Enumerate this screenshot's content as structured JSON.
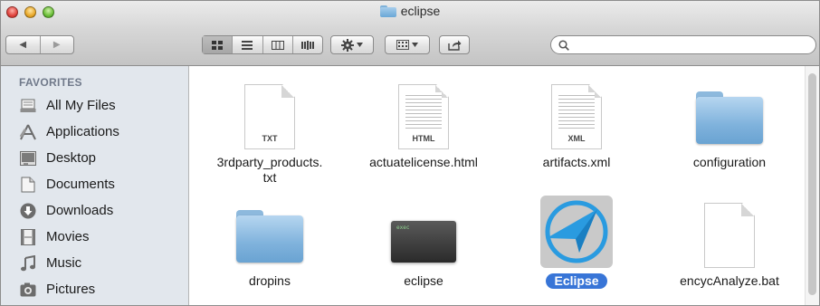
{
  "window": {
    "title": "eclipse"
  },
  "toolbar": {
    "back_icon": "◀",
    "forward_icon": "▶",
    "search": {
      "placeholder": ""
    }
  },
  "sidebar": {
    "heading": "FAVORITES",
    "items": [
      {
        "label": "All My Files",
        "icon": "all-files-icon"
      },
      {
        "label": "Applications",
        "icon": "applications-icon"
      },
      {
        "label": "Desktop",
        "icon": "desktop-icon"
      },
      {
        "label": "Documents",
        "icon": "documents-icon"
      },
      {
        "label": "Downloads",
        "icon": "downloads-icon"
      },
      {
        "label": "Movies",
        "icon": "movies-icon"
      },
      {
        "label": "Music",
        "icon": "music-icon"
      },
      {
        "label": "Pictures",
        "icon": "pictures-icon"
      }
    ]
  },
  "files": [
    {
      "name": "3rdparty_products.\ntxt",
      "type": "document",
      "tag": "TXT"
    },
    {
      "name": "actuatelicense.html",
      "type": "document",
      "tag": "HTML"
    },
    {
      "name": "artifacts.xml",
      "type": "document",
      "tag": "XML"
    },
    {
      "name": "configuration",
      "type": "folder"
    },
    {
      "name": "dropins",
      "type": "folder"
    },
    {
      "name": "eclipse",
      "type": "executable",
      "terminal_text": "exec"
    },
    {
      "name": "Eclipse",
      "type": "application",
      "selected": true
    },
    {
      "name": "encycAnalyze.bat",
      "type": "document",
      "tag": ""
    }
  ],
  "colors": {
    "selection": "#3875d7",
    "sidebar_bg": "#e2e7ed",
    "sidebar_heading": "#70798a"
  }
}
